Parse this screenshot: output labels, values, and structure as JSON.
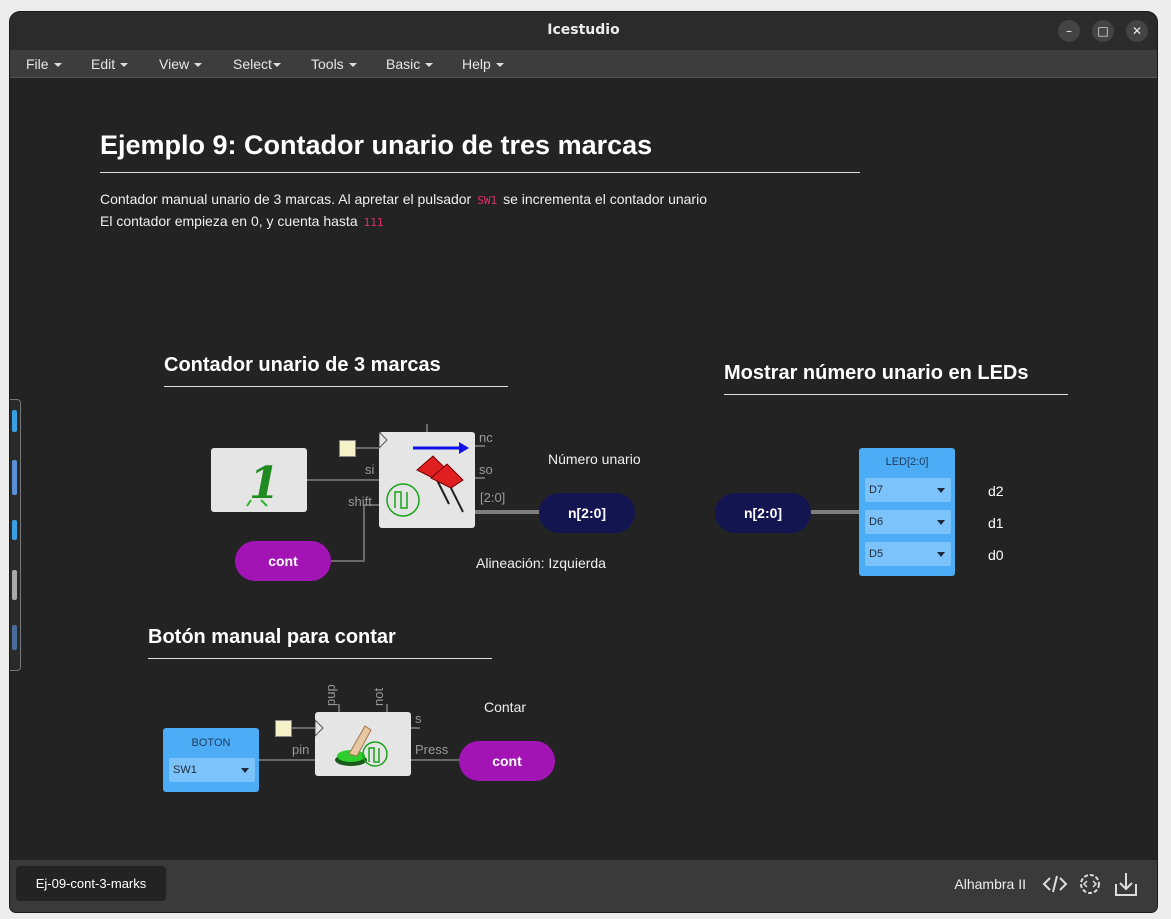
{
  "window": {
    "title": "Icestudio",
    "controls": [
      "minimize-icon",
      "maximize-icon",
      "close-icon"
    ]
  },
  "menu": [
    {
      "label": "File"
    },
    {
      "label": "Edit"
    },
    {
      "label": "View"
    },
    {
      "label": "Select"
    },
    {
      "label": "Tools"
    },
    {
      "label": "Basic"
    },
    {
      "label": "Help"
    }
  ],
  "doc": {
    "title": "Ejemplo 9: Contador unario de tres marcas",
    "line1_a": "Contador manual unario de 3 marcas. Al apretar el pulsador",
    "line1_code": "SW1",
    "line1_b": "se incrementa el contador unario",
    "line2_a": "El contador empieza en 0, y cuenta hasta",
    "line2_code": "111"
  },
  "sections": {
    "counter": "Contador unario de 3 marcas",
    "leds": "Mostrar número unario en LEDs",
    "button": "Botón manual para contar"
  },
  "counter": {
    "ports_right": [
      "nc",
      "so",
      "[2:0]"
    ],
    "ports_left": [
      "si",
      "shift"
    ],
    "const_label": "cont",
    "output_label": "n[2:0]",
    "note_top": "Número unario",
    "note_bottom": "Alineación: Izquierda"
  },
  "leds": {
    "input_label": "n[2:0]",
    "block_title": "LED[2:0]",
    "pins": [
      "D7",
      "D6",
      "D5"
    ],
    "outputs": [
      "d2",
      "d1",
      "d0"
    ]
  },
  "button": {
    "block_title": "BOTON",
    "pin": "SW1",
    "port_in": "pin",
    "ports_top": [
      "pup",
      "not"
    ],
    "port_s": "s",
    "port_press": "Press",
    "output_label": "cont",
    "note": "Contar"
  },
  "status": {
    "file_tab": "Ej-09-cont-3-marks",
    "board": "Alhambra II",
    "icons": [
      "code-icon",
      "settings-icon",
      "download-icon"
    ]
  },
  "colors": {
    "accent_purple": "#a314b5",
    "accent_navy": "#131550",
    "io_blue": "#4cadf6"
  }
}
